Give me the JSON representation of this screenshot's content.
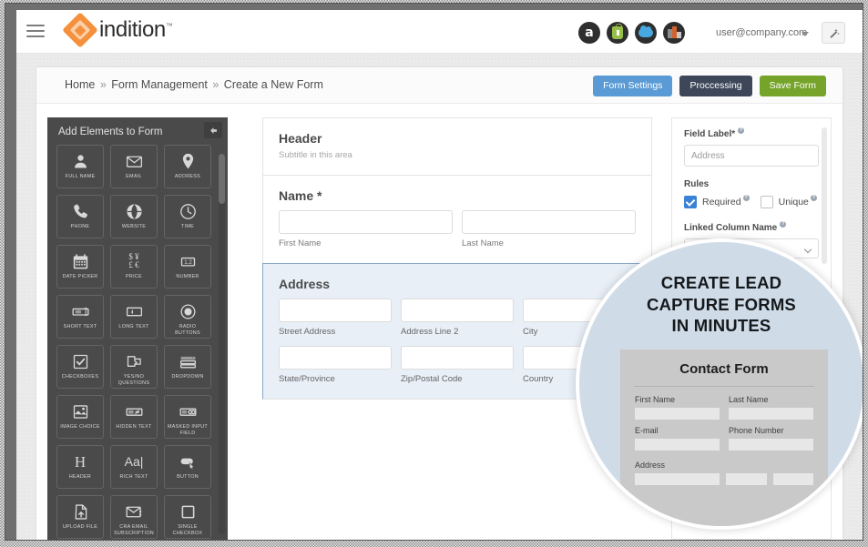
{
  "topbar": {
    "menu_icon": "hamburger-icon",
    "logo_text": "indition",
    "logo_tm": "™",
    "platform_icons": [
      {
        "name": "amazon-icon",
        "glyph": "a"
      },
      {
        "name": "shopify-icon",
        "glyph": ""
      },
      {
        "name": "salesforce-icon",
        "glyph": ""
      },
      {
        "name": "bigcommerce-icon",
        "glyph": ""
      }
    ],
    "user_email": "user@company.com",
    "wand_icon": "magic-wand-icon"
  },
  "breadcrumb": {
    "home": "Home",
    "sep": "»",
    "section": "Form Management",
    "current": "Create a New Form"
  },
  "actions": {
    "form_settings": "Form Settings",
    "processing": "Proccessing",
    "save_form": "Save Form"
  },
  "elements_panel": {
    "title": "Add Elements to Form",
    "collapse_icon": "collapse-left-icon",
    "items": [
      {
        "label": "FULL NAME",
        "icon": "person-icon"
      },
      {
        "label": "EMAIL",
        "icon": "envelope-icon"
      },
      {
        "label": "ADDRESS",
        "icon": "map-pin-icon"
      },
      {
        "label": "PHONE",
        "icon": "phone-icon"
      },
      {
        "label": "WEBSITE",
        "icon": "globe-icon"
      },
      {
        "label": "TIME",
        "icon": "clock-icon"
      },
      {
        "label": "DATE PICKER",
        "icon": "calendar-icon"
      },
      {
        "label": "PRICE",
        "icon": "currency-icon"
      },
      {
        "label": "NUMBER",
        "icon": "number-icon"
      },
      {
        "label": "SHORT TEXT",
        "icon": "short-text-icon"
      },
      {
        "label": "LONG TEXT",
        "icon": "long-text-icon"
      },
      {
        "label": "RADIO BUTTONS",
        "icon": "radio-button-icon"
      },
      {
        "label": "CHECKBOXES",
        "icon": "checkbox-icon"
      },
      {
        "label": "YES/NO QUESTIONS",
        "icon": "yes-no-icon"
      },
      {
        "label": "DROPDOWN",
        "icon": "dropdown-icon"
      },
      {
        "label": "IMAGE CHOICE",
        "icon": "image-icon"
      },
      {
        "label": "HIDDEN TEXT",
        "icon": "hidden-text-icon"
      },
      {
        "label": "MASKED INPUT FIELD",
        "icon": "masked-input-icon"
      },
      {
        "label": "HEADER",
        "icon": "header-h-icon"
      },
      {
        "label": "RICH TEXT",
        "icon": "rich-text-icon"
      },
      {
        "label": "BUTTON",
        "icon": "button-icon"
      },
      {
        "label": "UPLOAD FILE",
        "icon": "upload-file-icon"
      },
      {
        "label": "CRA EMAIL SUBSCRIPTION",
        "icon": "email-subscription-icon"
      },
      {
        "label": "SINGLE CHECKBOX",
        "icon": "single-checkbox-icon"
      }
    ]
  },
  "canvas": {
    "header_block": {
      "title": "Header",
      "subtitle": "Subtitle in this area"
    },
    "name_block": {
      "title": "Name *",
      "fields": [
        {
          "label": "First Name",
          "value": ""
        },
        {
          "label": "Last Name",
          "value": ""
        }
      ]
    },
    "address_block": {
      "title": "Address",
      "selected": true,
      "row1": [
        {
          "label": "Street Address",
          "value": ""
        },
        {
          "label": "Address Line 2",
          "value": ""
        },
        {
          "label": "City",
          "value": ""
        }
      ],
      "row2": [
        {
          "label": "State/Province",
          "value": ""
        },
        {
          "label": "Zip/Postal Code",
          "value": ""
        },
        {
          "label": "Country",
          "value": ""
        }
      ]
    }
  },
  "properties": {
    "field_label_title": "Field Label*",
    "field_label_value": "Address",
    "rules_title": "Rules",
    "required_label": "Required",
    "required_checked": true,
    "unique_label": "Unique",
    "unique_checked": false,
    "linked_column_title": "Linked Column Name",
    "linked_column_value": "",
    "info_glyph": "?"
  },
  "magnifier": {
    "headline_line1": "CREATE LEAD",
    "headline_line2": "CAPTURE FORMS",
    "headline_line3": "IN MINUTES",
    "card_title": "Contact Form",
    "fields": [
      {
        "label": "First Name"
      },
      {
        "label": "Last Name"
      },
      {
        "label": "E-mail"
      },
      {
        "label": "Phone Number"
      }
    ],
    "address_label": "Address"
  },
  "colors": {
    "brand_orange": "#f5903c",
    "settings_blue": "#5b9bd5",
    "processing_dark": "#3d4759",
    "save_green": "#76a42a",
    "panel_dark": "#4a4a4a",
    "selected_blue": "#e8eff7",
    "magnifier_bg": "#cfdce8"
  }
}
